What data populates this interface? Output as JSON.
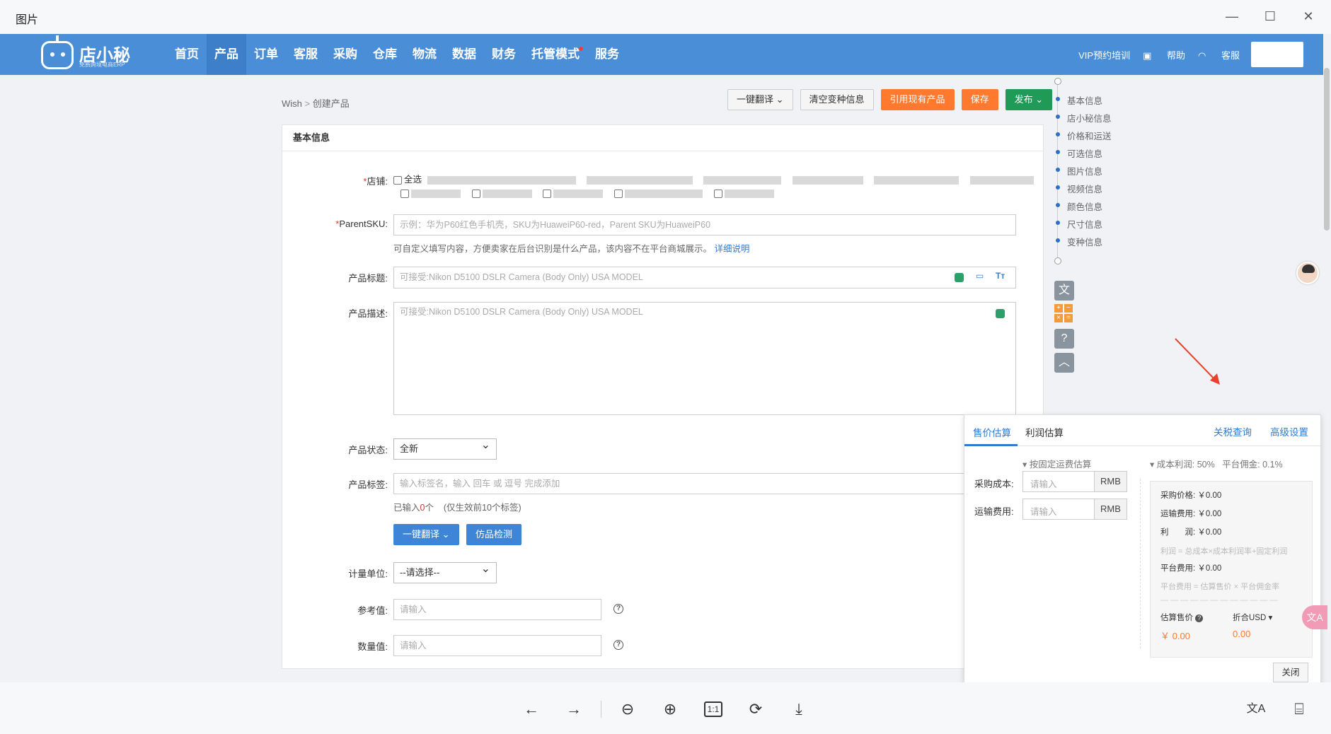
{
  "viewer": {
    "title": "图片",
    "controls": {
      "minimize": "—",
      "maximize": "☐",
      "close": "✕"
    },
    "bottom_icons": [
      "arrow-left-icon",
      "arrow-right-icon",
      "zoom-out-icon",
      "zoom-in-icon",
      "actual-size-icon",
      "rotate-icon",
      "download-icon",
      "translate-icon",
      "ocr-icon"
    ],
    "actual_size_label": "1:1"
  },
  "app": {
    "logo_name": "店小秘",
    "logo_sub": "免费跨境电商ERP",
    "nav": [
      "首页",
      "产品",
      "订单",
      "客服",
      "采购",
      "仓库",
      "物流",
      "数据",
      "财务",
      "托管模式",
      "服务"
    ],
    "nav_active": "产品",
    "nav_right": {
      "vip": "VIP预约培训",
      "help": "帮助",
      "service": "客服"
    }
  },
  "breadcrumb": {
    "root": "Wish",
    "sep": ">",
    "current": "创建产品"
  },
  "toolbar": {
    "translate": "一键翻译",
    "clear": "清空变种信息",
    "reference": "引用现有产品",
    "save": "保存",
    "publish": "发布"
  },
  "form": {
    "section_title": "基本信息",
    "shop_label": "店铺:",
    "select_all": "全选",
    "parent_sku_label": "ParentSKU:",
    "parent_sku_placeholder": "示例：华为P60红色手机壳，SKU为HuaweiP60-red，Parent SKU为HuaweiP60",
    "parent_sku_hint": "可自定义填写内容，方便卖家在后台识别是什么产品，该内容不在平台商城展示。",
    "parent_sku_link": "详细说明",
    "title_label": "产品标题:",
    "title_placeholder": "可接受:Nikon D5100 DSLR Camera (Body Only) USA MODEL",
    "desc_label": "产品描述:",
    "desc_placeholder": "可接受:Nikon D5100 DSLR Camera (Body Only) USA MODEL",
    "status_label": "产品状态:",
    "status_value": "全新",
    "tags_label": "产品标签:",
    "tags_placeholder": "输入标签名，输入 回车 或 逗号 完成添加",
    "tags_count_prefix": "已输入",
    "tags_count": "0",
    "tags_count_suffix": "个",
    "tags_limit": "(仅生效前10个标签)",
    "translate_btn": "一键翻译",
    "counterfeit_btn": "仿品检测",
    "unit_label": "计量单位:",
    "unit_value": "--请选择--",
    "ref_label": "参考值:",
    "ref_placeholder": "请输入",
    "qty_label": "数量值:",
    "qty_placeholder": "请输入"
  },
  "side_nav": [
    "基本信息",
    "店小秘信息",
    "价格和运送",
    "可选信息",
    "图片信息",
    "视频信息",
    "颜色信息",
    "尺寸信息",
    "变种信息"
  ],
  "price_popup": {
    "tab_price": "售价估算",
    "tab_profit": "利润估算",
    "tariff_link": "关税查询",
    "advanced_link": "高级设置",
    "fixed_shipping": "按固定运费估算",
    "cost_margin_label": "成本利润:",
    "cost_margin": "50%",
    "commission_label": "平台佣金:",
    "commission": "0.1%",
    "purchase_cost_label": "采购成本:",
    "shipping_cost_label": "运输费用:",
    "input_placeholder": "请输入",
    "currency": "RMB",
    "sum_purchase": "采购价格: ￥0.00",
    "sum_shipping": "运输费用: ￥0.00",
    "sum_profit": "利　　润: ￥0.00",
    "profit_note": "利润 = 总成本×成本利润率+固定利润",
    "sum_platform": "平台费用: ￥0.00",
    "platform_note": "平台费用 = 估算售价 × 平台佣金率",
    "dashes": "— — — — — — — — — — — —",
    "est_price_label": "估算售价",
    "usd_label": "折合USD",
    "est_price": "￥ 0.00",
    "usd_value": "0.00",
    "close": "关闭"
  },
  "colors": {
    "nav_bg": "#4a8ed8",
    "orange": "#ff7a2f",
    "green": "#1f9a57",
    "link": "#2f7bd3"
  }
}
